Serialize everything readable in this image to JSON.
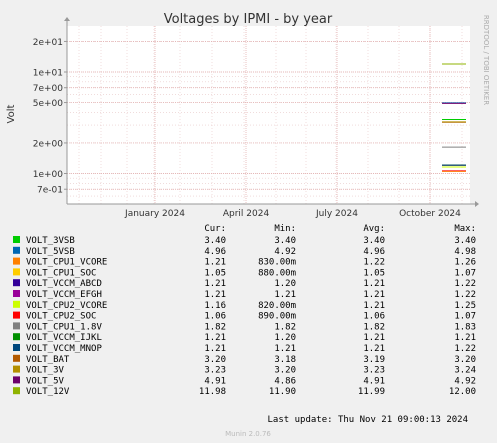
{
  "chart_data": {
    "type": "line",
    "title": "Voltages by IPMI - by year",
    "ylabel": "Volt",
    "xlabel": "",
    "yscale": "log",
    "ylim": [
      0.5,
      30
    ],
    "y_ticks": [
      {
        "value": 0.7,
        "label": "7e-01"
      },
      {
        "value": 1,
        "label": "1e+00"
      },
      {
        "value": 2,
        "label": "2e+00"
      },
      {
        "value": 5,
        "label": "5e+00"
      },
      {
        "value": 7,
        "label": "7e+00"
      },
      {
        "value": 10,
        "label": "1e+01"
      },
      {
        "value": 20,
        "label": "2e+01"
      }
    ],
    "x_ticks": [
      "January 2024",
      "April 2024",
      "July 2024",
      "October 2024"
    ],
    "grid": true,
    "side_label": "RRDTOOL / TOBI OETIKER",
    "columns": [
      "Cur:",
      "Min:",
      "Avg:",
      "Max:"
    ],
    "series": [
      {
        "name": "VOLT_3VSB",
        "color": "#00cc00",
        "cur": "3.40",
        "min": "3.40",
        "avg": "3.40",
        "max": "3.40",
        "value": 3.4
      },
      {
        "name": "VOLT_5VSB",
        "color": "#0066b3",
        "cur": "4.96",
        "min": "4.92",
        "avg": "4.96",
        "max": "4.98",
        "value": 4.96
      },
      {
        "name": "VOLT_CPU1_VCORE",
        "color": "#ff8000",
        "cur": "1.21",
        "min": "830.00m",
        "avg": "1.22",
        "max": "1.26",
        "value": 1.21
      },
      {
        "name": "VOLT_CPU1_SOC",
        "color": "#ffcc00",
        "cur": "1.05",
        "min": "880.00m",
        "avg": "1.05",
        "max": "1.07",
        "value": 1.05
      },
      {
        "name": "VOLT_VCCM_ABCD",
        "color": "#330099",
        "cur": "1.21",
        "min": "1.20",
        "avg": "1.21",
        "max": "1.22",
        "value": 1.21
      },
      {
        "name": "VOLT_VCCM_EFGH",
        "color": "#990099",
        "cur": "1.21",
        "min": "1.21",
        "avg": "1.21",
        "max": "1.22",
        "value": 1.21
      },
      {
        "name": "VOLT_CPU2_VCORE",
        "color": "#ccff00",
        "cur": "1.16",
        "min": "820.00m",
        "avg": "1.21",
        "max": "1.25",
        "value": 1.16
      },
      {
        "name": "VOLT_CPU2_SOC",
        "color": "#ff0000",
        "cur": "1.06",
        "min": "890.00m",
        "avg": "1.06",
        "max": "1.07",
        "value": 1.06
      },
      {
        "name": "VOLT_CPU1_1.8V",
        "color": "#808080",
        "cur": "1.82",
        "min": "1.82",
        "avg": "1.82",
        "max": "1.83",
        "value": 1.82
      },
      {
        "name": "VOLT_VCCM_IJKL",
        "color": "#008f00",
        "cur": "1.21",
        "min": "1.20",
        "avg": "1.21",
        "max": "1.21",
        "value": 1.21
      },
      {
        "name": "VOLT_VCCM_MNOP",
        "color": "#00487d",
        "cur": "1.21",
        "min": "1.21",
        "avg": "1.21",
        "max": "1.22",
        "value": 1.21
      },
      {
        "name": "VOLT_BAT",
        "color": "#b35a00",
        "cur": "3.20",
        "min": "3.18",
        "avg": "3.19",
        "max": "3.20",
        "value": 3.2
      },
      {
        "name": "VOLT_3V",
        "color": "#b38f00",
        "cur": "3.23",
        "min": "3.20",
        "avg": "3.23",
        "max": "3.24",
        "value": 3.23
      },
      {
        "name": "VOLT_5V",
        "color": "#6b006b",
        "cur": "4.91",
        "min": "4.86",
        "avg": "4.91",
        "max": "4.92",
        "value": 4.91
      },
      {
        "name": "VOLT_12V",
        "color": "#8fb300",
        "cur": "11.98",
        "min": "11.90",
        "avg": "11.99",
        "max": "12.00",
        "value": 11.98
      }
    ],
    "last_update": "Last update: Thu Nov 21 09:00:13 2024",
    "footer": "Munin 2.0.76"
  }
}
